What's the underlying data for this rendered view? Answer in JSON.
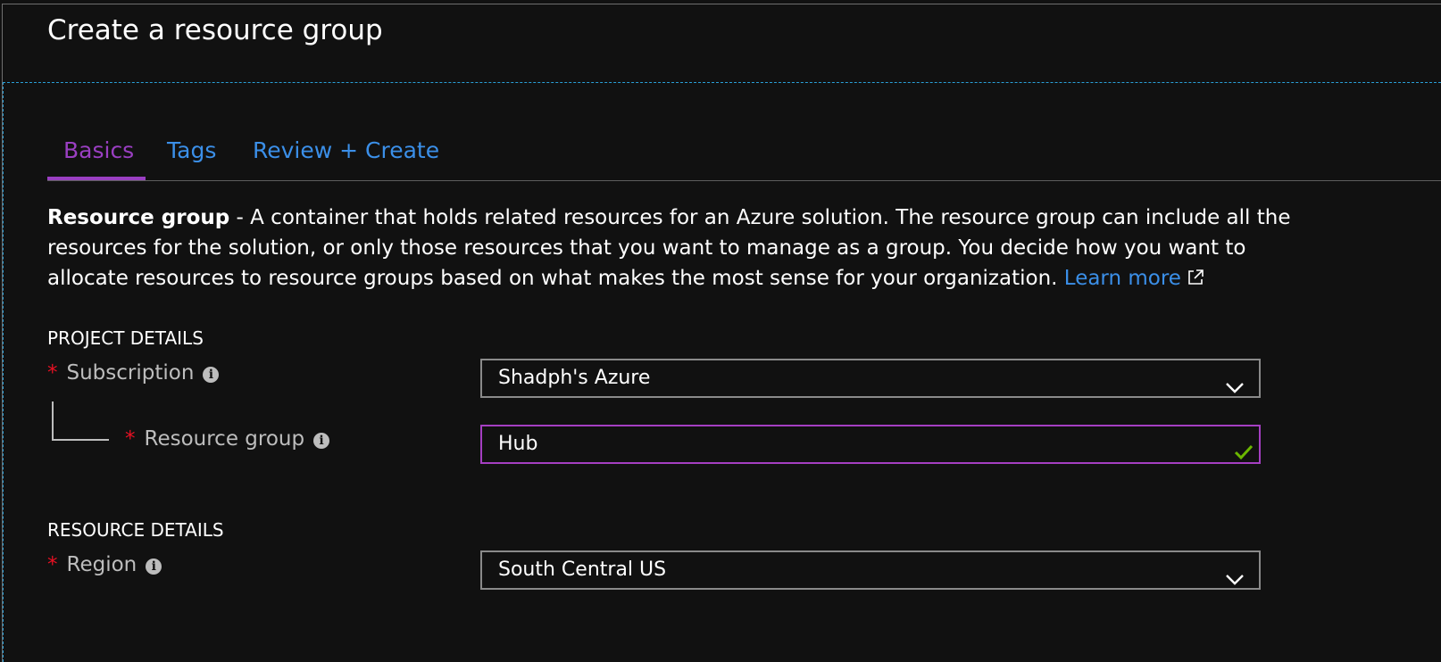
{
  "header": {
    "title": "Create a resource group"
  },
  "tabs": [
    {
      "label": "Basics",
      "active": true
    },
    {
      "label": "Tags",
      "active": false
    },
    {
      "label": "Review + Create",
      "active": false
    }
  ],
  "description": {
    "bold": "Resource group",
    "text": " - A container that holds related resources for an Azure solution. The resource group can include all the resources for the solution, or only those resources that you want to manage as a group. You decide how you want to allocate resources to resource groups based on what makes the most sense for your organization. ",
    "link": "Learn more",
    "link_icon": "external-link-icon"
  },
  "project_details": {
    "heading": "PROJECT DETAILS",
    "subscription": {
      "required": "*",
      "label": "Subscription",
      "value": "Shadph's Azure",
      "icon": "chevron-down-icon"
    },
    "resource_group": {
      "required": "*",
      "label": "Resource group",
      "value": "Hub",
      "icon": "checkmark-icon"
    }
  },
  "resource_details": {
    "heading": "RESOURCE DETAILS",
    "region": {
      "required": "*",
      "label": "Region",
      "value": "South Central US",
      "icon": "chevron-down-icon"
    }
  },
  "info_icon_glyph": "i",
  "colors": {
    "background": "#111111",
    "active_tab": "#9a3fc2",
    "link": "#3b8fe8",
    "required": "#e81123",
    "valid_check": "#6bb700",
    "focus_dash": "#2aa0d8"
  }
}
